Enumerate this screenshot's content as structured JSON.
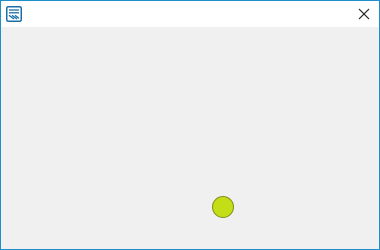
{
  "window": {
    "border_color": "#1f8fc9",
    "titlebar_color": "#ffffff",
    "content_color": "#f0f0f0",
    "app_icon": "app-logo-icon",
    "close_icon": "close-icon"
  },
  "indicator": {
    "color": "#c3dd17",
    "border_color": "#7f8c1e"
  }
}
